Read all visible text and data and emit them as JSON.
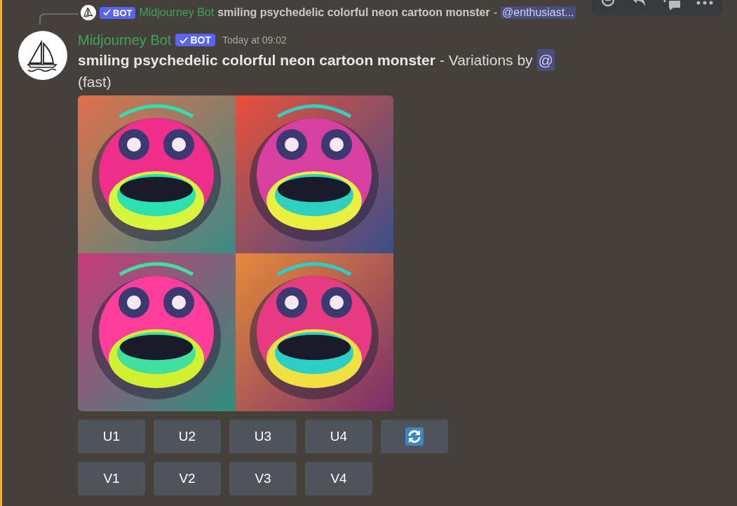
{
  "reply": {
    "bot_badge": "BOT",
    "author": "Midjourney Bot",
    "prompt": "smiling psychedelic colorful neon cartoon monster",
    "separator": "-",
    "mention": "@enthusiast..."
  },
  "message": {
    "author": "Midjourney Bot",
    "bot_badge": "BOT",
    "timestamp": "Today at 09:02",
    "prompt": "smiling psychedelic colorful neon cartoon monster",
    "suffix": "- Variations by",
    "mention": "@",
    "mode": "(fast)"
  },
  "images": [
    {
      "kind": "picture"
    },
    {
      "kind": "picture"
    },
    {
      "kind": "picture"
    },
    {
      "kind": "picture"
    }
  ],
  "button_rows": [
    [
      {
        "kind": "text",
        "label": "U1"
      },
      {
        "kind": "text",
        "label": "U2"
      },
      {
        "kind": "text",
        "label": "U3"
      },
      {
        "kind": "text",
        "label": "U4"
      },
      {
        "kind": "refresh"
      }
    ],
    [
      {
        "kind": "text",
        "label": "V1"
      },
      {
        "kind": "text",
        "label": "V2"
      },
      {
        "kind": "text",
        "label": "V3"
      },
      {
        "kind": "text",
        "label": "V4"
      }
    ]
  ]
}
